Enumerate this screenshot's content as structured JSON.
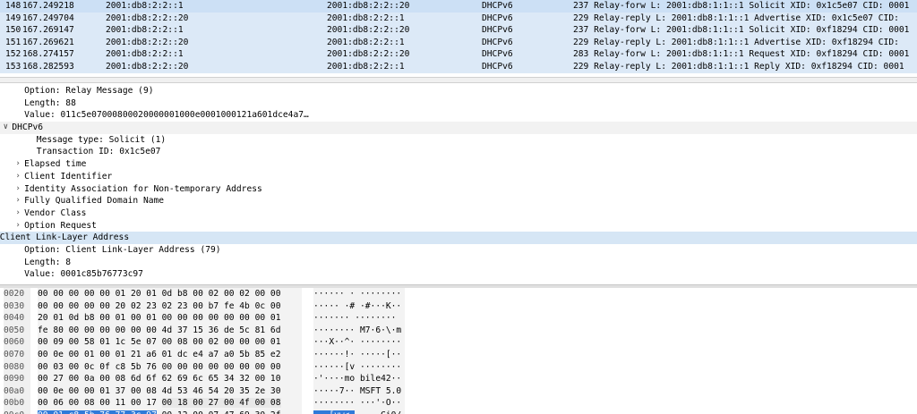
{
  "packets": [
    {
      "no": "148",
      "time": "167.249218",
      "src": "2001:db8:2:2::1",
      "dst": "2001:db8:2:2::20",
      "proto": "DHCPv6",
      "info": "237 Relay-forw L: 2001:db8:1:1::1 Solicit XID: 0x1c5e07 CID: 0001"
    },
    {
      "no": "149",
      "time": "167.249704",
      "src": "2001:db8:2:2::20",
      "dst": "2001:db8:2:2::1",
      "proto": "DHCPv6",
      "info": "229 Relay-reply L: 2001:db8:1:1::1 Advertise XID: 0x1c5e07 CID:"
    },
    {
      "no": "150",
      "time": "167.269147",
      "src": "2001:db8:2:2::1",
      "dst": "2001:db8:2:2::20",
      "proto": "DHCPv6",
      "info": "237 Relay-forw L: 2001:db8:1:1::1 Solicit XID: 0xf18294 CID: 0001"
    },
    {
      "no": "151",
      "time": "167.269621",
      "src": "2001:db8:2:2::20",
      "dst": "2001:db8:2:2::1",
      "proto": "DHCPv6",
      "info": "229 Relay-reply L: 2001:db8:1:1::1 Advertise XID: 0xf18294 CID:"
    },
    {
      "no": "152",
      "time": "168.274157",
      "src": "2001:db8:2:2::1",
      "dst": "2001:db8:2:2::20",
      "proto": "DHCPv6",
      "info": "283 Relay-forw L: 2001:db8:1:1::1 Request XID: 0xf18294 CID: 0001"
    },
    {
      "no": "153",
      "time": "168.282593",
      "src": "2001:db8:2:2::20",
      "dst": "2001:db8:2:2::1",
      "proto": "DHCPv6",
      "info": "229 Relay-reply L: 2001:db8:1:1::1 Reply XID: 0xf18294 CID: 0001"
    }
  ],
  "details": [
    {
      "indent": 3,
      "expander": "",
      "text": "Option: Relay Message (9)"
    },
    {
      "indent": 3,
      "expander": "",
      "text": "Length: 88"
    },
    {
      "indent": 3,
      "expander": "",
      "text": "Value: 011c5e07000800020000001000e0001000121a601dce4a7…"
    },
    {
      "indent": 2,
      "expander": "v",
      "text": "DHCPv6",
      "section": true
    },
    {
      "indent": 4,
      "expander": "",
      "text": "Message type: Solicit (1)"
    },
    {
      "indent": 4,
      "expander": "",
      "text": "Transaction ID: 0x1c5e07"
    },
    {
      "indent": 3,
      "expander": ">",
      "text": "Elapsed time"
    },
    {
      "indent": 3,
      "expander": ">",
      "text": "Client Identifier"
    },
    {
      "indent": 3,
      "expander": ">",
      "text": "Identity Association for Non-temporary Address"
    },
    {
      "indent": 3,
      "expander": ">",
      "text": "Fully Qualified Domain Name"
    },
    {
      "indent": 3,
      "expander": ">",
      "text": "Vendor Class"
    },
    {
      "indent": 3,
      "expander": ">",
      "text": "Option Request"
    },
    {
      "indent": 1,
      "expander": "v",
      "text": "Client Link-Layer Address",
      "selected": true
    },
    {
      "indent": 3,
      "expander": "",
      "text": "Option: Client Link-Layer Address (79)"
    },
    {
      "indent": 3,
      "expander": "",
      "text": "Length: 8"
    },
    {
      "indent": 3,
      "expander": "",
      "text": "Value: 0001c85b76773c97"
    }
  ],
  "hex": [
    {
      "off": "0020",
      "b1": "00 00 00 00 00 01 20 01",
      "b2": "0d b8 00 02 00 02 00 00",
      "a1": "······ ·",
      "a2": " ········"
    },
    {
      "off": "0030",
      "b1": "00 00 00 00 00 20 02 23",
      "b2": "02 23 00 b7 fe 4b 0c 00",
      "a1": "····· ·#",
      "a2": " ·#···K··"
    },
    {
      "off": "0040",
      "b1": "20 01 0d b8 00 01 00 01",
      "b2": "00 00 00 00 00 00 00 01",
      "a1": " ·······",
      "a2": " ········"
    },
    {
      "off": "0050",
      "b1": "fe 80 00 00 00 00 00 00",
      "b2": "4d 37 15 36 de 5c 81 6d",
      "a1": "········",
      "a2": " M7·6·\\·m"
    },
    {
      "off": "0060",
      "b1": "00 09 00 58 01 1c 5e 07",
      "b2": "00 08 00 02 00 00 00 01",
      "a1": "···X··^·",
      "a2": " ········"
    },
    {
      "off": "0070",
      "b1": "00 0e 00 01 00 01 21 a6",
      "b2": "01 dc e4 a7 a0 5b 85 e2",
      "a1": "······!·",
      "a2": " ·····[··"
    },
    {
      "off": "0080",
      "b1": "00 03 00 0c 0f c8 5b 76",
      "b2": "00 00 00 00 00 00 00 00",
      "a1": "······[v",
      "a2": " ········"
    },
    {
      "off": "0090",
      "b1": "00 27 00 0a 00 08 6d 6f",
      "b2": "62 69 6c 65 34 32 00 10",
      "a1": "·'····mo",
      "a2": " bile42··"
    },
    {
      "off": "00a0",
      "b1": "00 0e 00 00 01 37 00 08",
      "b2": "4d 53 46 54 20 35 2e 30",
      "a1": "·····7··",
      "a2": " MSFT 5.0"
    },
    {
      "off": "00b0",
      "b1": "00 06 00 08 00 11 00 17",
      "b2": "00 18 00 27 00 4f 00 08",
      "a1": "········",
      "a2": " ···'·O··"
    },
    {
      "off": "00c0",
      "b1": "00 01 c8 5b 76 77 3c 97",
      "b2": "00 12 00 07 47 69 30 2f",
      "a1": "···[vw<·",
      "a2": " ····Gi0/"
    }
  ]
}
